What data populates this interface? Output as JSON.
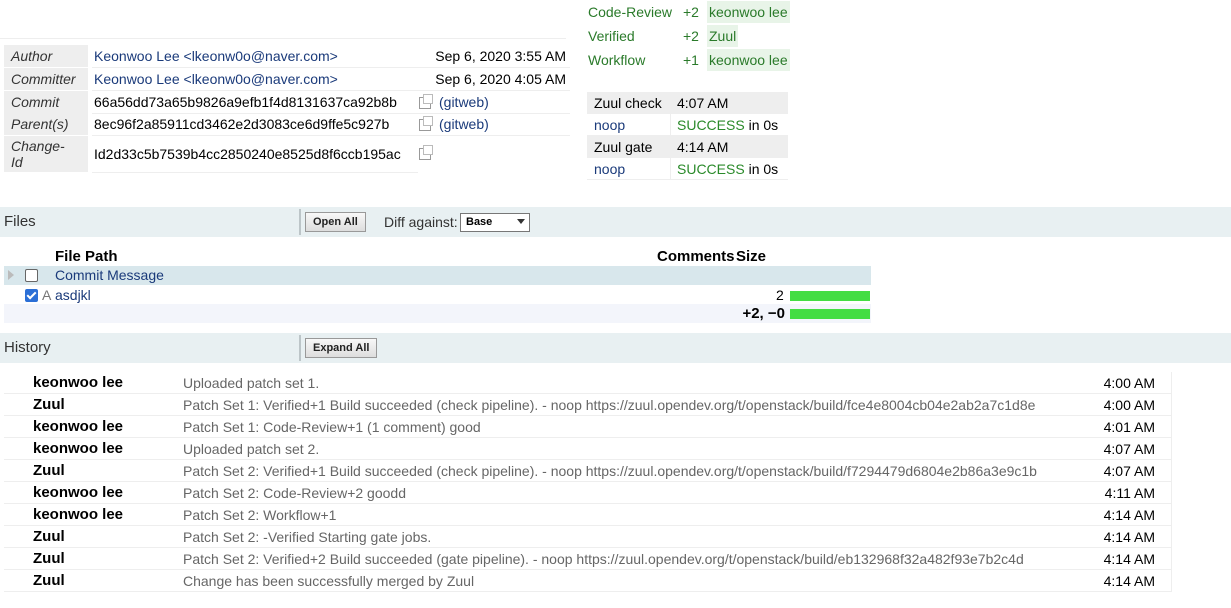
{
  "commit_info": {
    "author_label": "Author",
    "author_value": "Keonwoo Lee <lkeonw0o@naver.com>",
    "author_date": "Sep 6, 2020 3:55 AM",
    "committer_label": "Committer",
    "committer_value": "Keonwoo Lee <lkeonw0o@naver.com>",
    "committer_date": "Sep 6, 2020 4:05 AM",
    "commit_label": "Commit",
    "commit_value": "66a56dd73a65b9826a9efb1f4d8131637ca92b8b",
    "commit_link": "(gitweb)",
    "parent_label": "Parent(s)",
    "parent_value": "8ec96f2a85911cd3462e2d3083ce6d9ffe5c927b",
    "parent_link": "(gitweb)",
    "changeid_label_1": "Change-",
    "changeid_label_2": "Id",
    "changeid_value": "Id2d33c5b7539b4cc2850240e8525d8f6ccb195ac"
  },
  "labels": [
    {
      "name": "Code-Review",
      "value": "+2",
      "user": "keonwoo lee"
    },
    {
      "name": "Verified",
      "value": "+2",
      "user": "Zuul"
    },
    {
      "name": "Workflow",
      "value": "+1",
      "user": "keonwoo lee"
    }
  ],
  "zuul": [
    {
      "pipeline": "Zuul check",
      "time": "4:07 AM",
      "job": "noop",
      "result": "SUCCESS",
      "duration": " in 0s"
    },
    {
      "pipeline": "Zuul gate",
      "time": "4:14 AM",
      "job": "noop",
      "result": "SUCCESS",
      "duration": " in 0s"
    }
  ],
  "files_section": {
    "title": "Files",
    "open_all": "Open All",
    "diff_against_label": "Diff against:",
    "diff_against_value": "Base",
    "col_path": "File Path",
    "col_comments": "Comments",
    "col_size": "Size",
    "commit_message": "Commit Message",
    "file_status": "A",
    "file_name": "asdjkl",
    "file_size": "2",
    "total": "+2, −0"
  },
  "history_section": {
    "title": "History",
    "expand_all": "Expand All",
    "entries": [
      {
        "author": "keonwoo lee",
        "message": "Uploaded patch set 1.",
        "time": "4:00 AM"
      },
      {
        "author": "Zuul",
        "message": "Patch Set 1: Verified+1 Build succeeded (check pipeline). - noop https://zuul.opendev.org/t/openstack/build/fce4e8004cb04e2ab2a7c1d8e",
        "time": "4:00 AM"
      },
      {
        "author": "keonwoo lee",
        "message": "Patch Set 1: Code-Review+1 (1 comment) good",
        "time": "4:01 AM"
      },
      {
        "author": "keonwoo lee",
        "message": "Uploaded patch set 2.",
        "time": "4:07 AM"
      },
      {
        "author": "Zuul",
        "message": "Patch Set 2: Verified+1 Build succeeded (check pipeline). - noop https://zuul.opendev.org/t/openstack/build/f7294479d6804e2b86a3e9c1b",
        "time": "4:07 AM"
      },
      {
        "author": "keonwoo lee",
        "message": "Patch Set 2: Code-Review+2 goodd",
        "time": "4:11 AM"
      },
      {
        "author": "keonwoo lee",
        "message": "Patch Set 2: Workflow+1",
        "time": "4:14 AM"
      },
      {
        "author": "Zuul",
        "message": "Patch Set 2: -Verified Starting gate jobs.",
        "time": "4:14 AM"
      },
      {
        "author": "Zuul",
        "message": "Patch Set 2: Verified+2 Build succeeded (gate pipeline). - noop https://zuul.opendev.org/t/openstack/build/eb132968f32a482f93e7b2c4d",
        "time": "4:14 AM"
      },
      {
        "author": "Zuul",
        "message": "Change has been successfully merged by Zuul",
        "time": "4:14 AM"
      }
    ]
  },
  "colors": {
    "section_bg": "#e8f0f2",
    "success_green": "#2a8a2a",
    "size_bar": "#44dd44"
  }
}
